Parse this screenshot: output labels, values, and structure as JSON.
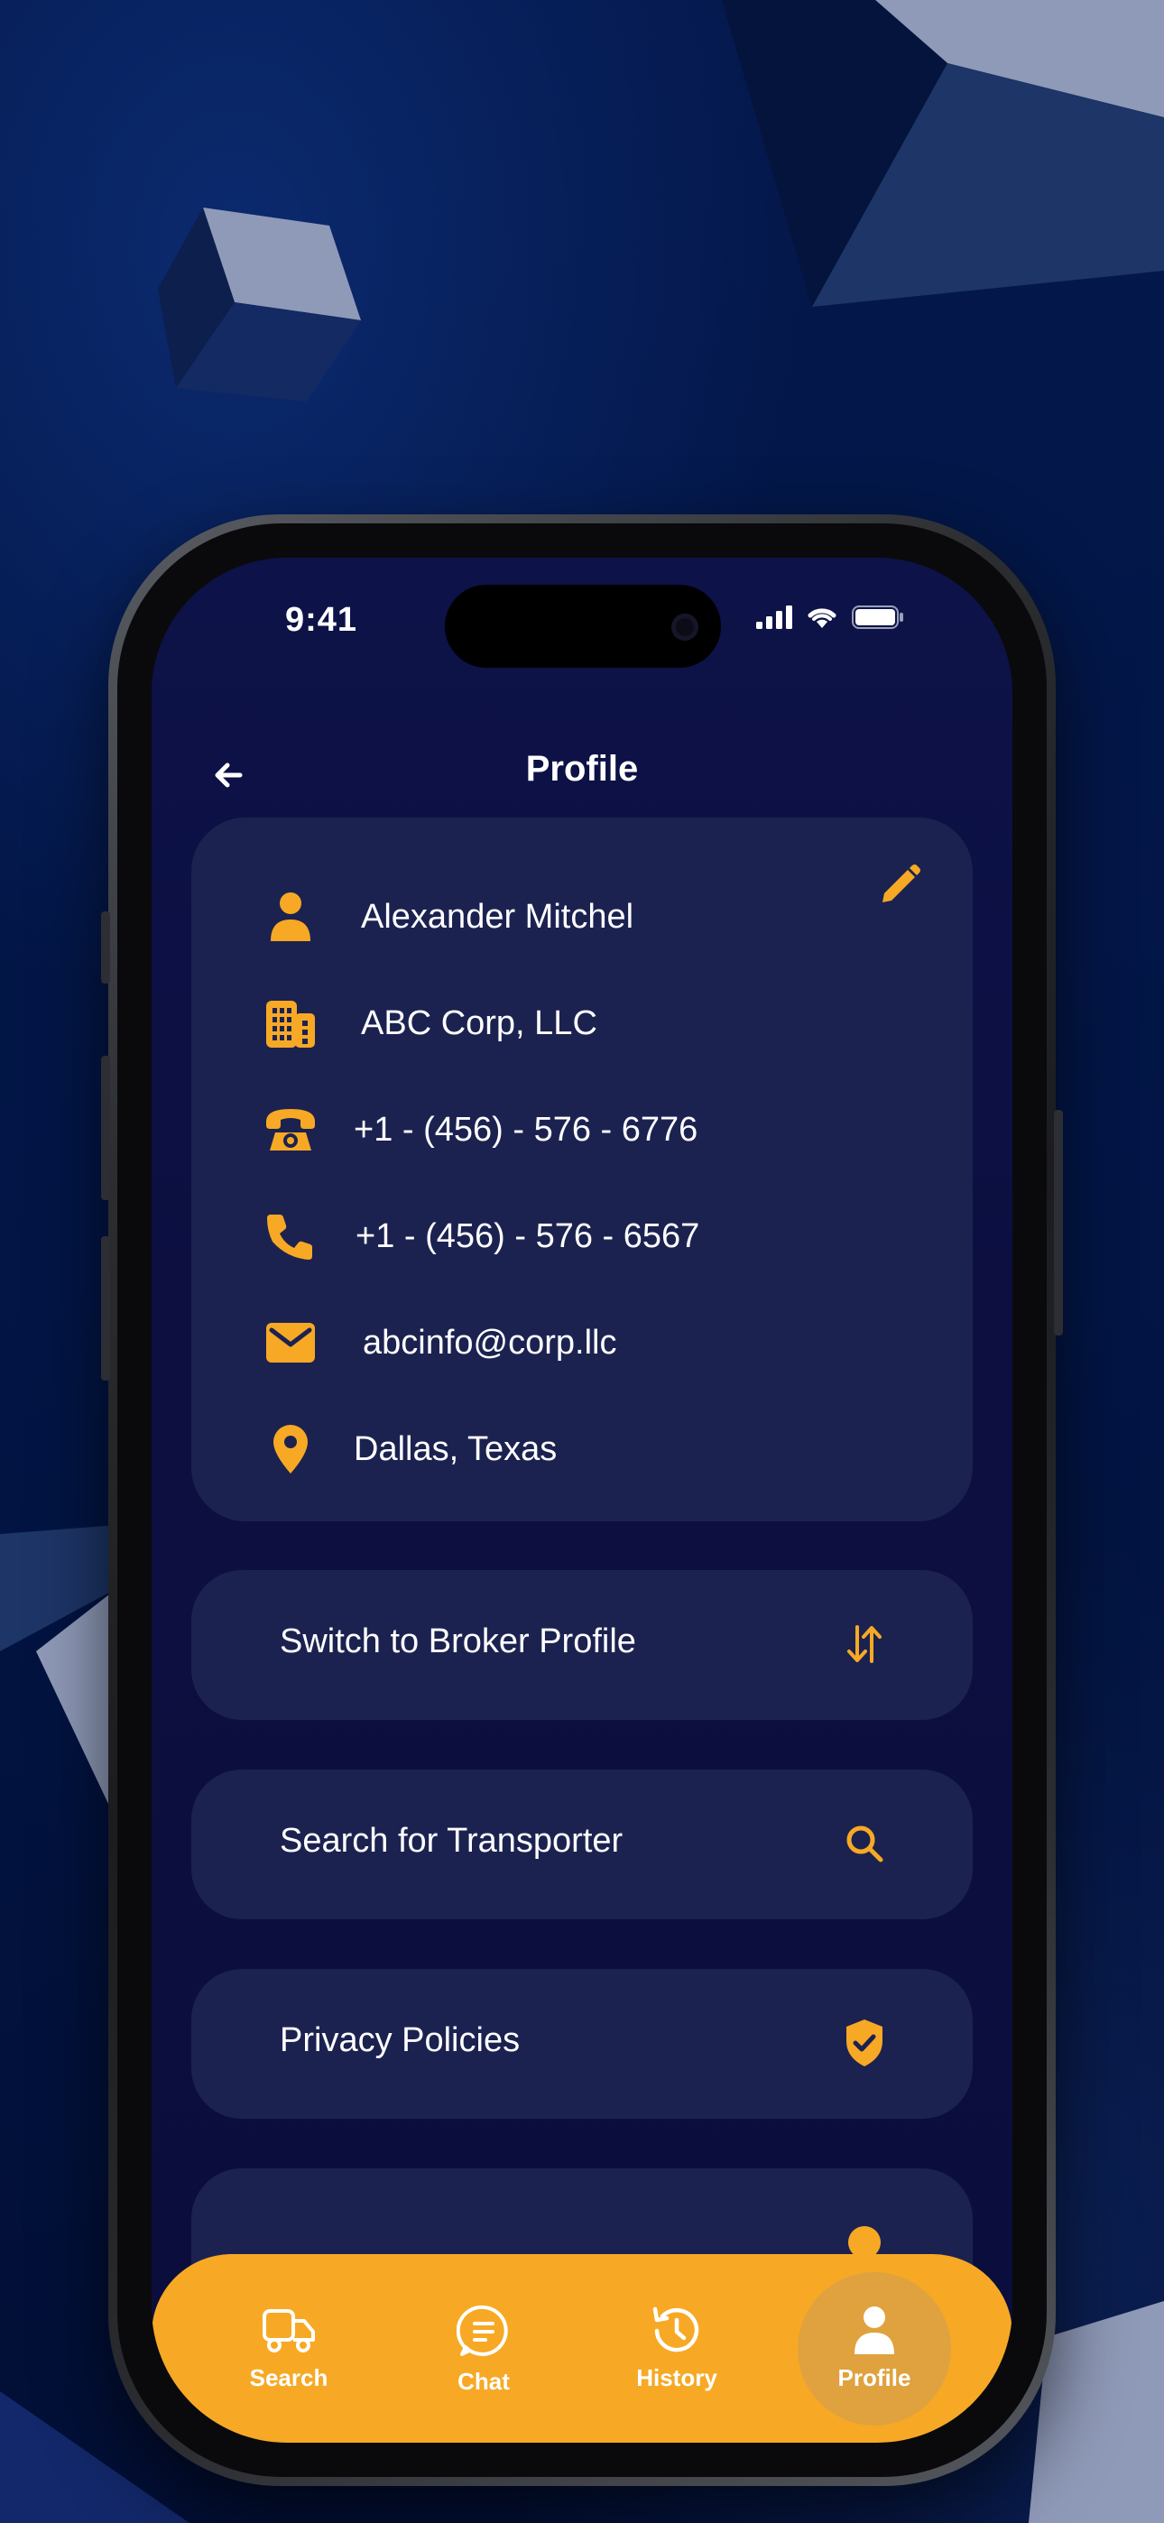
{
  "status_bar": {
    "time": "9:41"
  },
  "header": {
    "title": "Profile"
  },
  "profile": {
    "name": "Alexander Mitchel",
    "company": "ABC Corp, LLC",
    "phone_landline": "+1 - (456) - 576 - 6776",
    "phone_mobile": "+1 - (456) - 576 - 6567",
    "email": "abcinfo@corp.llc",
    "location": "Dallas, Texas"
  },
  "menu": [
    {
      "label": "Switch to Broker Profile",
      "icon": "swap-vertical-icon"
    },
    {
      "label": "Search for Transporter",
      "icon": "search-icon"
    },
    {
      "label": "Privacy Policies",
      "icon": "shield-check-icon"
    }
  ],
  "tabs": [
    {
      "label": "Search",
      "icon": "truck-icon"
    },
    {
      "label": "Chat",
      "icon": "chat-icon"
    },
    {
      "label": "History",
      "icon": "history-icon"
    },
    {
      "label": "Profile",
      "icon": "user-icon",
      "active": true
    }
  ],
  "colors": {
    "accent": "#f7a925",
    "card": "#1c2250",
    "screen_bg": "#0d1248",
    "page_bg": "#03174a",
    "text": "#ffffff"
  }
}
